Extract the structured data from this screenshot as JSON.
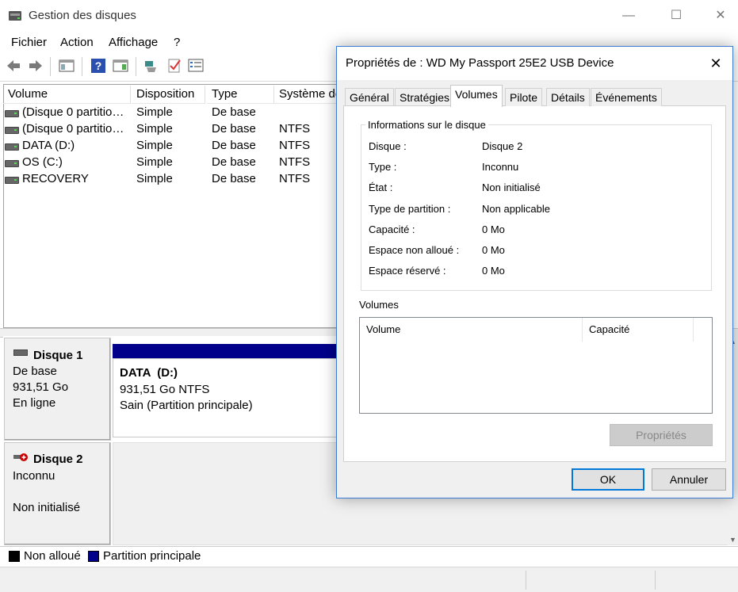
{
  "window": {
    "title": "Gestion des disques",
    "controls": {
      "minimize": "—",
      "maximize": "☐",
      "close": "✕"
    }
  },
  "menu": [
    "Fichier",
    "Action",
    "Affichage",
    "?"
  ],
  "toolbar_icons": [
    "back-arrow-icon",
    "forward-arrow-icon",
    "console-tree-icon",
    "help-icon",
    "action-pane-icon",
    "connect-icon",
    "check-icon",
    "properties-icon"
  ],
  "list": {
    "headers": [
      "Volume",
      "Disposition",
      "Type",
      "Système de fichiers"
    ],
    "rows": [
      [
        "(Disque 0 partitio…",
        "Simple",
        "De base",
        ""
      ],
      [
        "(Disque 0 partitio…",
        "Simple",
        "De base",
        "NTFS"
      ],
      [
        "DATA (D:)",
        "Simple",
        "De base",
        "NTFS"
      ],
      [
        "OS (C:)",
        "Simple",
        "De base",
        "NTFS"
      ],
      [
        "RECOVERY",
        "Simple",
        "De base",
        "NTFS"
      ]
    ]
  },
  "disks": [
    {
      "name": "Disque 1",
      "type": "De base",
      "size": "931,51 Go",
      "status": "En ligne"
    },
    {
      "name": "Disque 2",
      "type": "Inconnu",
      "size": "",
      "status": "Non initialisé"
    }
  ],
  "partition": {
    "name": "DATA  (D:)",
    "size_fs": "931,51 Go NTFS",
    "health": "Sain (Partition principale)",
    "bar_color": "#00008b"
  },
  "legend": [
    {
      "label": "Non alloué",
      "color": "#000000"
    },
    {
      "label": "Partition principale",
      "color": "#00008b"
    }
  ],
  "dialog": {
    "title": "Propriétés de : WD My Passport 25E2 USB Device",
    "close": "✕",
    "tabs": [
      "Général",
      "Stratégies",
      "Volumes",
      "Pilote",
      "Détails",
      "Événements"
    ],
    "active_tab": "Volumes",
    "group_title": "Informations sur le disque",
    "properties": [
      {
        "key": "Disque :",
        "value": "Disque 2"
      },
      {
        "key": "Type :",
        "value": "Inconnu"
      },
      {
        "key": "État :",
        "value": "Non initialisé"
      },
      {
        "key": "Type de partition :",
        "value": "Non applicable"
      },
      {
        "key": "Capacité :",
        "value": "0 Mo"
      },
      {
        "key": "Espace non alloué :",
        "value": "0 Mo"
      },
      {
        "key": "Espace réservé :",
        "value": "0 Mo"
      }
    ],
    "volumes_label": "Volumes",
    "volume_headers": [
      "Volume",
      "Capacité"
    ],
    "buttons": {
      "properties": "Propriétés",
      "ok": "OK",
      "cancel": "Annuler"
    }
  }
}
